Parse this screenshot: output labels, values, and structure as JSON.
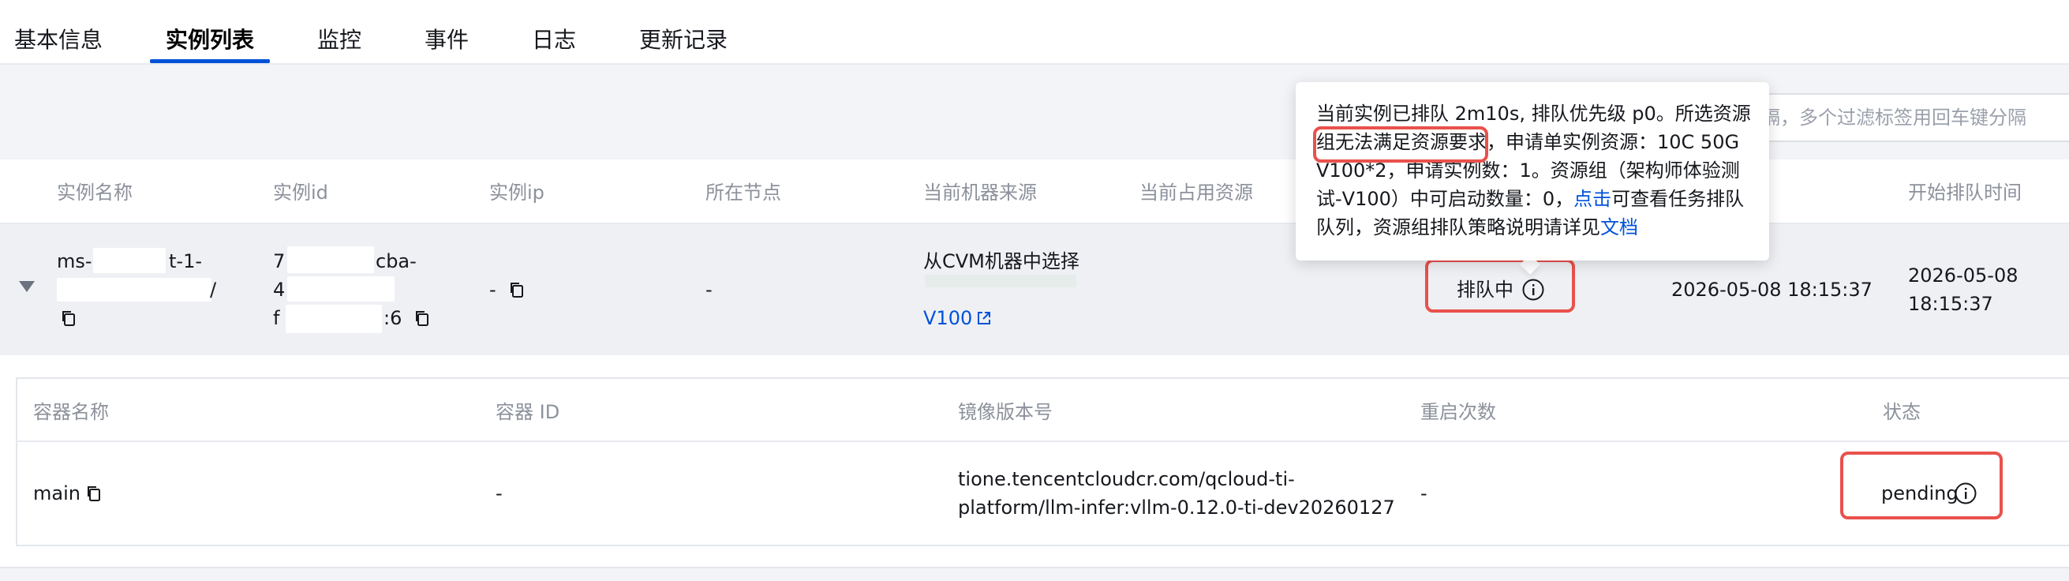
{
  "tabs": [
    {
      "label": "基本信息",
      "active": false
    },
    {
      "label": "实例列表",
      "active": true
    },
    {
      "label": "监控",
      "active": false
    },
    {
      "label": "事件",
      "active": false
    },
    {
      "label": "日志",
      "active": false
    },
    {
      "label": "更新记录",
      "active": false
    }
  ],
  "filter": {
    "search_placeholder": "分隔，多个过滤标签用回车键分隔"
  },
  "main_table": {
    "headers": [
      "实例名称",
      "实例id",
      "实例ip",
      "所在节点",
      "当前机器来源",
      "当前占用资源",
      "开始排队时间"
    ],
    "row": {
      "name_line1_start": "ms-",
      "name_line1_end": "t-1-",
      "name_line2_end": "/",
      "id_line1_start": "7",
      "id_line1_end": "cba-",
      "id_line2_start": "4",
      "id_line3_start": "f",
      "id_line3_end": ":6",
      "ip": "-",
      "node": "-",
      "machine_source": "从CVM机器中选择",
      "machine_type_link": "V100",
      "status": "排队中",
      "create_time": "2026-05-08 18:15:37",
      "queue_time_line1": "2026-05-08",
      "queue_time_line2": "18:15:37"
    }
  },
  "tooltip": {
    "line1": "当前实例已排队 2m10s, 排队优先级 p0。所选资源",
    "line2_prefix": "组",
    "line2_highlight": "无法满足资源要求",
    "line2_suffix": "，申请单实例资源：10C 50G",
    "line3": "V100*2，申请实例数：1。资源组（架构师体验测",
    "line4_prefix": "试-V100）中可启动数量：0，",
    "line4_link": "点击",
    "line4_suffix": "可查看任务排队",
    "line5_prefix": "队列，资源组排队策略说明请详见",
    "line5_link": "文档"
  },
  "container_table": {
    "headers": [
      "容器名称",
      "容器 ID",
      "镜像版本号",
      "重启次数",
      "状态"
    ],
    "row": {
      "name": "main",
      "container_id": "-",
      "image_line1": "tione.tencentcloudcr.com/qcloud-ti-",
      "image_line2": "platform/llm-infer:vllm-0.12.0-ti-dev20260127",
      "restarts": "-",
      "status": "pending"
    }
  },
  "colors": {
    "accent": "#0052d9",
    "highlight_red": "#e9514c"
  },
  "icons": [
    "copy-icon",
    "external-link-icon",
    "info-circle-icon",
    "caret-down-icon"
  ]
}
